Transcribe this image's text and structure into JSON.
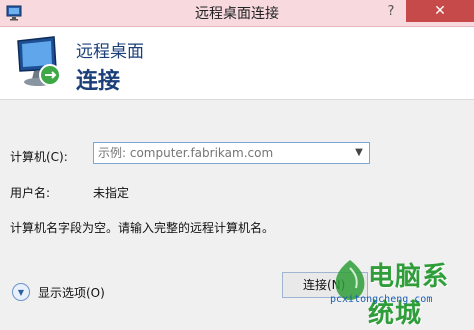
{
  "window": {
    "title": "远程桌面连接",
    "help_glyph": "?",
    "close_glyph": "✕"
  },
  "header": {
    "line1": "远程桌面",
    "line2": "连接"
  },
  "form": {
    "computer_label": "计算机(C):",
    "computer_placeholder": "示例: computer.fabrikam.com",
    "username_label": "用户名:",
    "username_value": "未指定",
    "message": "计算机名字段为空。请输入完整的远程计算机名。"
  },
  "footer": {
    "options_label": "显示选项(O)",
    "connect_label": "连接(N)"
  },
  "watermark": {
    "title": "电脑系统城",
    "url": "pcxitongcheng.com"
  },
  "colors": {
    "titlebar": "#f7d9de",
    "header_text": "#1b3f79",
    "close_button": "#c74a4a",
    "watermark_green": "#2f9e3a"
  },
  "icons": {
    "app": "remote-desktop-icon",
    "combo_arrow": "chevron-down-icon",
    "options": "chevron-down-circle-icon"
  }
}
